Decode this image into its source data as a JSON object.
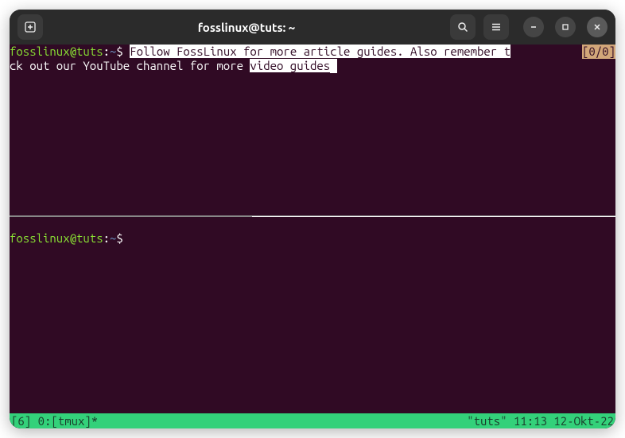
{
  "titlebar": {
    "title": "fosslinux@tuts: ~"
  },
  "panes": {
    "top": {
      "prompt_user_host": "fosslinux@tuts",
      "prompt_sep": ":",
      "prompt_path": "~",
      "prompt_dollar": "$",
      "line1_highlight": "Follow FossLinux for more article guides. Also remember t",
      "search_indicator": "[0/0]",
      "line2_nonhighlight": "ck out our YouTube channel for more ",
      "line2_highlight": "video guides"
    },
    "bottom": {
      "prompt_user_host": "fosslinux@tuts",
      "prompt_sep": ":",
      "prompt_path": "~",
      "prompt_dollar": "$"
    }
  },
  "statusbar": {
    "left": "[6] 0:[tmux]*",
    "right": "\"tuts\" 11:13 12-Okt-22"
  }
}
